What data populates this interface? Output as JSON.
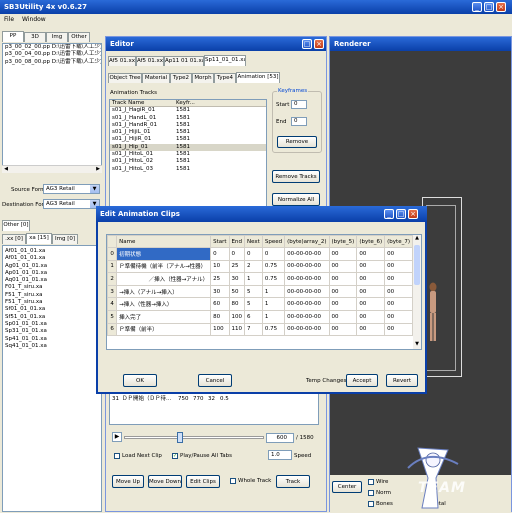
{
  "app": {
    "title": "SB3Utility 4x v0.6.27",
    "menu": [
      "File",
      "Window"
    ]
  },
  "left": {
    "tabs": [
      "PP",
      "3D",
      "Img",
      "Other"
    ],
    "files": [
      "p3_00_02_00.pp D:\\迅雷下载\\人工少女",
      "p3_00_04_00.pp D:\\迅雷下载\\人工少女",
      "p3_00_08_00.pp D:\\迅雷下载\\人工少女"
    ],
    "source_format_label": "Source Format",
    "source_format_value": "AG3 Retail",
    "dest_format_label": "Destination Format",
    "dest_format_value": "AG3 Retail",
    "other_tab": "Other [0]",
    "sub_tabs": [
      ".xx [0]",
      "xa [15]",
      "Img [0]"
    ],
    "items": [
      "Af01_01_01.xa",
      "Af01_01_01.xa",
      "Ag01_01_01.xa",
      "Ap01_01_01.xa",
      "Aq01_01_01.xa",
      "F01_T_siru.xa",
      "F51_T_siru.xa",
      "F51_T_siru.xa",
      "Sf01_01_01.xa",
      "Sf51_01_01.xa",
      "Sp01_01_01.xa",
      "Sp31_01_01.xa",
      "Sp41_01_01.xa",
      "Sq41_01_01.xa"
    ]
  },
  "editor": {
    "title": "Editor",
    "file_tabs": [
      "Af5 01.xx",
      "Af5 01.xx",
      "Ap11 01 01.xa",
      "Sp11_01_01.xa"
    ],
    "sub_tabs": [
      "Object Tree",
      "Material",
      "Type2",
      "Morph",
      "Type4",
      "Animation [53]"
    ],
    "anim_tracks_label": "Animation Tracks",
    "track_header": {
      "name": "Track Name",
      "keyframes": "Keyfr..."
    },
    "tracks": [
      {
        "name": "s01_J_HagiR_01",
        "kf": "1581"
      },
      {
        "name": "s01_J_HandL_01",
        "kf": "1581"
      },
      {
        "name": "s01_J_HandR_01",
        "kf": "1581"
      },
      {
        "name": "s01_J_HijiL_01",
        "kf": "1581"
      },
      {
        "name": "s01_J_HijiR_01",
        "kf": "1581"
      },
      {
        "name": "s01_J_Hip_01",
        "kf": "1581"
      },
      {
        "name": "s01_J_HitoL_01",
        "kf": "1581"
      },
      {
        "name": "s01_J_HitoL_02",
        "kf": "1581"
      },
      {
        "name": "s01_J_HitoL_03",
        "kf": "1581"
      }
    ],
    "keyframes": {
      "legend": "Keyframes",
      "start_label": "Start",
      "start_value": "0",
      "end_label": "End",
      "end_value": "0",
      "remove": "Remove"
    },
    "remove_tracks": "Remove Tracks",
    "normalize_all": "Normalize All",
    "lower_clips": [
      {
        "n": "30",
        "name": "外出し最中",
        "a": "1080",
        "b": "1180",
        "c": "49",
        "d": "10"
      },
      {
        "n": "31",
        "name": "ＤＰ開始（ＤＰ待...",
        "a": "750",
        "b": "770",
        "c": "32",
        "d": "0.5"
      }
    ],
    "frame_value": "600",
    "frame_total": "/ 1580",
    "load_next_clip": "Load Next Clip",
    "play_pause_all": "Play/Pause All Tabs",
    "speed_value": "1.0",
    "speed_label": "Speed",
    "move_up": "Move Up",
    "move_down": "Move Down",
    "edit_clips": "Edit Clips",
    "whole_track": "Whole Track",
    "track": "Track"
  },
  "renderer": {
    "title": "Renderer",
    "center": "Center",
    "options": [
      "Wire",
      "Norm",
      "Bones"
    ],
    "extra": "Skeletal"
  },
  "dialog": {
    "title": "Edit Animation Clips",
    "columns": [
      "",
      "Name",
      "Start",
      "End",
      "Next",
      "Speed",
      "(byte)array_2)",
      "(byte_5)",
      "(byte_6)",
      "(byte_7)"
    ],
    "rows": [
      [
        "0",
        "初期状態",
        "0",
        "0",
        "0",
        "0",
        "00-00-00-00",
        "00",
        "00",
        "00"
      ],
      [
        "1",
        "Ｐ準備待機（前半（アナル→性器）",
        "10",
        "25",
        "2",
        "0.75",
        "00-00-00-00",
        "00",
        "00",
        "00"
      ],
      [
        "2",
        "／挿入（性器→アナル）",
        "25",
        "30",
        "1",
        "0.75",
        "00-00-00-00",
        "00",
        "00",
        "00"
      ],
      [
        "3",
        "→挿入（アナル→挿入）",
        "30",
        "50",
        "5",
        "1",
        "00-00-00-00",
        "00",
        "00",
        "00"
      ],
      [
        "4",
        "→挿入（性器→挿入）",
        "60",
        "80",
        "5",
        "1",
        "00-00-00-00",
        "00",
        "00",
        "00"
      ],
      [
        "5",
        "挿入完了",
        "80",
        "100",
        "6",
        "1",
        "00-00-00-00",
        "00",
        "00",
        "00"
      ],
      [
        "6",
        "Ｐ準備（前半）",
        "100",
        "110",
        "7",
        "0.75",
        "00-00-00-00",
        "00",
        "00",
        "00"
      ]
    ],
    "ok": "OK",
    "cancel": "Cancel",
    "temp_changes": "Temp Changes:",
    "accept": "Accept",
    "revert": "Revert"
  },
  "watermark": "TEAM"
}
